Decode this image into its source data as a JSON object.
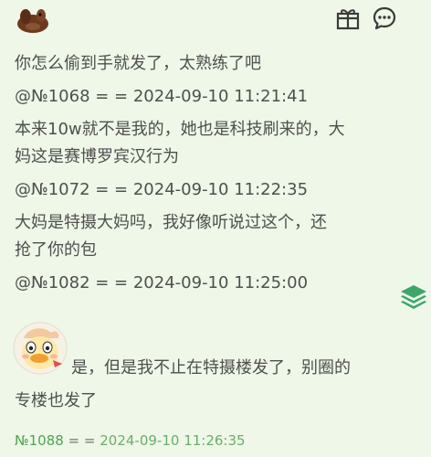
{
  "posts": [
    {
      "text": "你怎么偷到手就发了，太熟练了吧"
    },
    {
      "ref": "@№1068 = = 2024-09-10 11:21:41"
    },
    {
      "text": "本来10w就不是我的，她也是科技刷来的，大"
    },
    {
      "text": "妈这是赛博罗宾汉行为"
    },
    {
      "ref": "@№1072 = = 2024-09-10 11:22:35"
    },
    {
      "text": "大妈是特摄大妈吗，我好像听说过这个，还"
    },
    {
      "text": "抢了你的包"
    },
    {
      "ref": "@№1082 = = 2024-09-10 11:25:00"
    }
  ],
  "reply": {
    "line1": "是，但是我不止在特摄楼发了，别圈的",
    "line2": "专楼也发了"
  },
  "footer": {
    "no": "№1088",
    "eq": "= =",
    "datetime": "2024-09-10 11:26:35"
  },
  "icons": {
    "top_avatar": "cartoon-duck-avatar-icon",
    "gift": "gift-icon",
    "comment": "comment-bubble-icon",
    "layers": "layers-stack-icon",
    "sticker": "duck-sticker-icon"
  },
  "colors": {
    "background": "#EEF7E8",
    "text": "#4F4F4F",
    "accent_green": "#4FA44F"
  }
}
